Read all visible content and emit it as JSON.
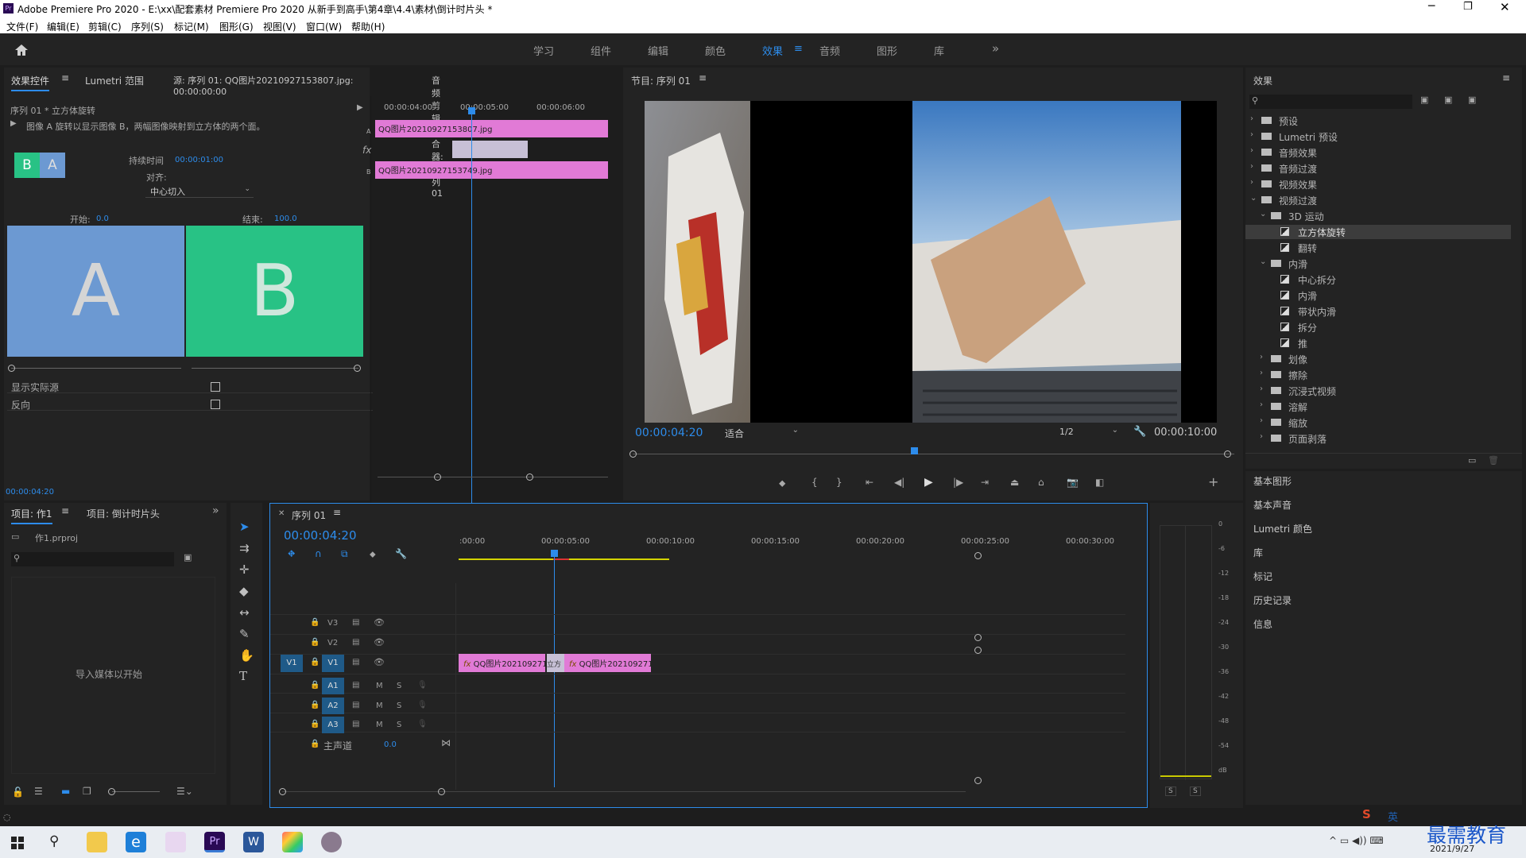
{
  "app": {
    "title": "Adobe Premiere Pro 2020 - E:\\xx\\配套素材 Premiere Pro 2020 从新手到高手\\第4章\\4.4\\素材\\倒计时片头 *",
    "icon": "Pr"
  },
  "menu": [
    "文件(F)",
    "编辑(E)",
    "剪辑(C)",
    "序列(S)",
    "标记(M)",
    "图形(G)",
    "视图(V)",
    "窗口(W)",
    "帮助(H)"
  ],
  "workspaces": [
    "学习",
    "组件",
    "编辑",
    "颜色",
    "效果",
    "音频",
    "图形",
    "库"
  ],
  "active_workspace": "效果",
  "effect_controls": {
    "tabs": [
      "效果控件",
      "Lumetri 范围",
      "源: 序列 01: QQ图片20210927153807.jpg: 00:00:00:00",
      "音频剪辑混合器: 序列 01"
    ],
    "clip_path": "序列 01 * 立方体旋转",
    "description": "图像 A 旋转以显示图像 B，两幅图像映射到立方体的两个面。",
    "duration_label": "持续时间",
    "duration_value": "00:00:01:00",
    "align_label": "对齐:",
    "align_value": "中心切入",
    "start_label": "开始:",
    "start_value": "0.0",
    "end_label": "结束:",
    "end_value": "100.0",
    "preview_a": "A",
    "preview_b": "B",
    "thumb_a": "A",
    "thumb_b": "B",
    "show_actual": "显示实际源",
    "reverse": "反向",
    "mini_times": [
      "00:00:04:00",
      "00:00:05:00",
      "00:00:06:00"
    ],
    "clip_a": "QQ图片20210927153807.jpg",
    "clip_b": "QQ图片20210927153749.jpg",
    "label_a": "A",
    "label_b": "B",
    "current_time": "00:00:04:20"
  },
  "program": {
    "title": "节目: 序列 01",
    "timecode": "00:00:04:20",
    "fit": "适合",
    "resolution": "1/2",
    "duration": "00:00:10:00"
  },
  "effects": {
    "title": "效果",
    "tree": [
      {
        "label": "预设",
        "level": 0
      },
      {
        "label": "Lumetri 预设",
        "level": 0
      },
      {
        "label": "音频效果",
        "level": 0
      },
      {
        "label": "音频过渡",
        "level": 0
      },
      {
        "label": "视频效果",
        "level": 0
      },
      {
        "label": "视频过渡",
        "level": 0,
        "open": true
      },
      {
        "label": "3D 运动",
        "level": 1,
        "open": true
      },
      {
        "label": "立方体旋转",
        "level": 2,
        "selected": true
      },
      {
        "label": "翻转",
        "level": 2
      },
      {
        "label": "内滑",
        "level": 1,
        "open": true
      },
      {
        "label": "中心拆分",
        "level": 2
      },
      {
        "label": "内滑",
        "level": 2
      },
      {
        "label": "带状内滑",
        "level": 2
      },
      {
        "label": "拆分",
        "level": 2
      },
      {
        "label": "推",
        "level": 2
      },
      {
        "label": "划像",
        "level": 1
      },
      {
        "label": "擦除",
        "level": 1
      },
      {
        "label": "沉浸式视频",
        "level": 1
      },
      {
        "label": "溶解",
        "level": 1
      },
      {
        "label": "缩放",
        "level": 1
      },
      {
        "label": "页面剥落",
        "level": 1
      }
    ],
    "panels": [
      "基本图形",
      "基本声音",
      "Lumetri 颜色",
      "库",
      "标记",
      "历史记录",
      "信息"
    ]
  },
  "project": {
    "tabs": [
      "项目: 作1",
      "项目: 倒计时片头"
    ],
    "file": "作1.prproj",
    "empty": "导入媒体以开始"
  },
  "timeline": {
    "tab": "序列 01",
    "timecode": "00:00:04:20",
    "ruler": [
      ":00:00",
      "00:00:05:00",
      "00:00:10:00",
      "00:00:15:00",
      "00:00:20:00",
      "00:00:25:00",
      "00:00:30:00"
    ],
    "video_tracks": [
      "V3",
      "V2",
      "V1"
    ],
    "audio_tracks": [
      "A1",
      "A2",
      "A3"
    ],
    "source_v": "V1",
    "master_label": "主声道",
    "master_value": "0.0",
    "clip1": "QQ图片2021092715",
    "clip2": "QQ图片2021092715",
    "transition": "立方",
    "msb": [
      "M",
      "S"
    ]
  },
  "meter": {
    "scale": [
      "0",
      "-6",
      "-12",
      "-18",
      "-24",
      "-30",
      "-36",
      "-42",
      "-48",
      "-54",
      "dB"
    ],
    "solo": [
      "S",
      "S"
    ]
  },
  "taskbar": {
    "watermark": "最需教育",
    "date": "2021/9/27",
    "ime": "英"
  },
  "colors": {
    "accent": "#2d8ceb",
    "clip": "#e17ad6",
    "thumb_a": "#6c99d2",
    "thumb_b": "#28c285"
  }
}
